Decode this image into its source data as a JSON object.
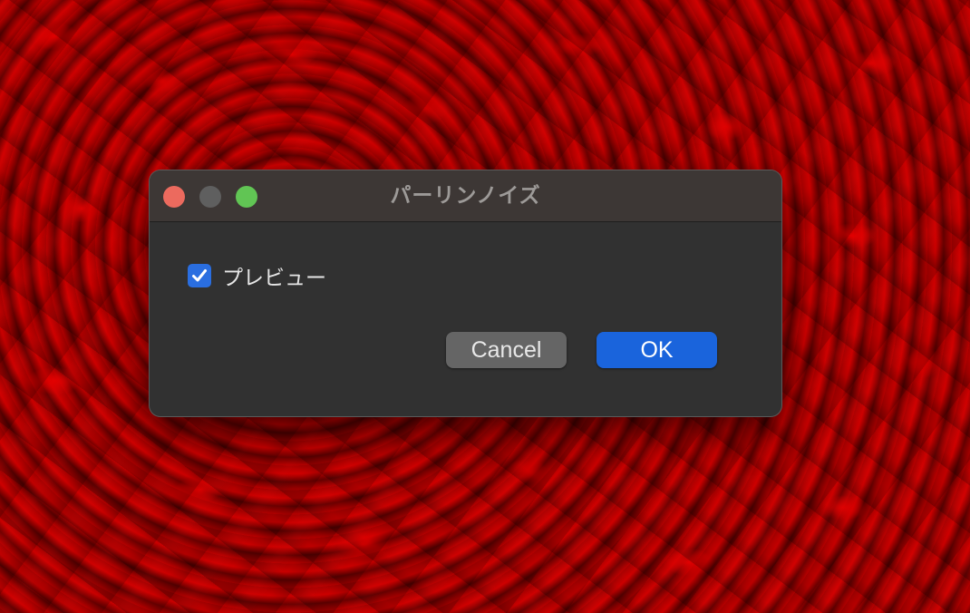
{
  "dialog": {
    "title": "パーリンノイズ",
    "preview": {
      "label": "プレビュー",
      "checked": true
    },
    "buttons": {
      "cancel_label": "Cancel",
      "ok_label": "OK"
    }
  },
  "window_controls": {
    "close_color": "#ec6a5e",
    "minimize_color": "#5f5f5f",
    "zoom_color": "#61c554"
  },
  "colors": {
    "accent": "#1a64dc",
    "checkbox": "#2a6ee0"
  },
  "icons": {
    "checkbox": "checkmark-icon"
  }
}
